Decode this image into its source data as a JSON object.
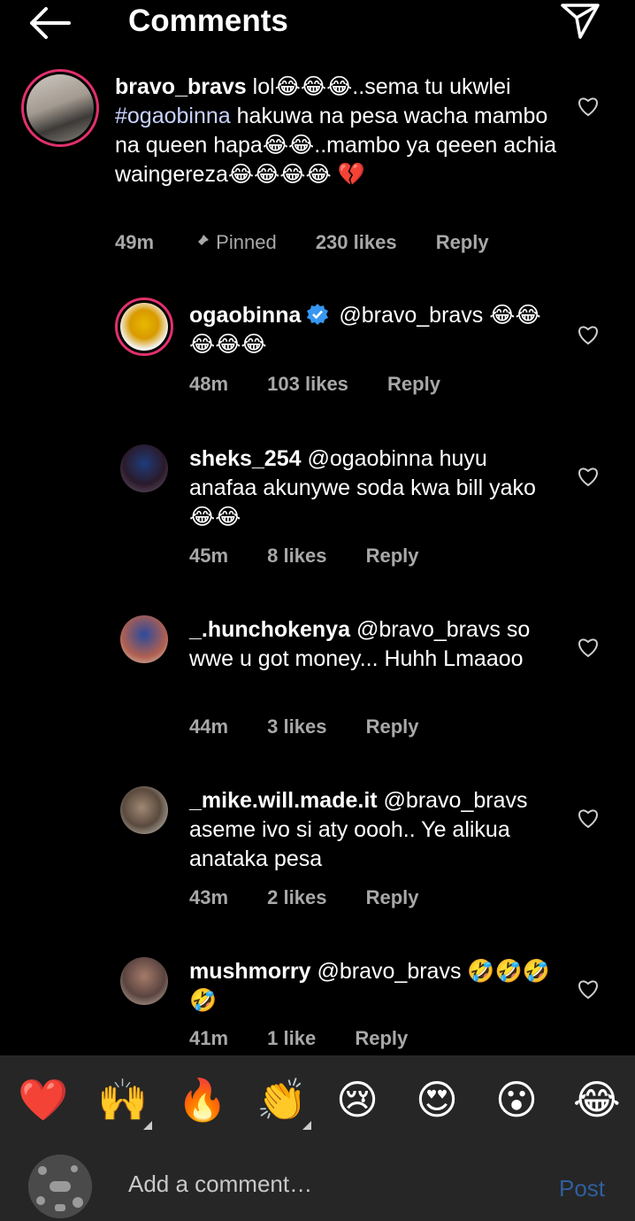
{
  "header": {
    "title": "Comments"
  },
  "comments": [
    {
      "username": "bravo_bravs",
      "text_parts": [
        "lol😂😂😂..sema tu ukwlei ",
        "#ogaobinna",
        " hakuwa na pesa wacha mambo na queen hapa😂😂..mambo ya qeeen achia waingereza😂😂😂😂 💔"
      ],
      "time": "49m",
      "pinned": "Pinned",
      "likes": "230 likes",
      "reply": "Reply"
    },
    {
      "username": "ogaobinna",
      "text": "@bravo_bravs 😂😂😂😂😂",
      "time": "48m",
      "likes": "103 likes",
      "reply": "Reply"
    },
    {
      "username": "sheks_254",
      "text": "@ogaobinna huyu anafaa akunywe soda kwa bill yako😂😂",
      "time": "45m",
      "likes": "8 likes",
      "reply": "Reply"
    },
    {
      "username": "_.hunchokenya",
      "text": "@bravo_bravs so wwe u got money... Huhh Lmaaoo",
      "time": "44m",
      "likes": "3 likes",
      "reply": "Reply"
    },
    {
      "username": "_mike.will.made.it",
      "text": "@bravo_bravs aseme ivo si aty oooh.. Ye alikua anataka pesa",
      "time": "43m",
      "likes": "2 likes",
      "reply": "Reply"
    },
    {
      "username": "mushmorry",
      "text": "@bravo_bravs 🤣🤣🤣🤣",
      "time": "41m",
      "likes": "1 like",
      "reply": "Reply"
    }
  ],
  "quick_reactions": [
    "❤️",
    "🙌",
    "🔥",
    "👏",
    "😢",
    "😍",
    "😮",
    "😂"
  ],
  "composer": {
    "placeholder": "Add a comment…",
    "post_label": "Post"
  },
  "colors": {
    "background": "#000000",
    "meta": "#a8a8a8",
    "post": "#2f5f9e",
    "verified": "#3897f0"
  }
}
